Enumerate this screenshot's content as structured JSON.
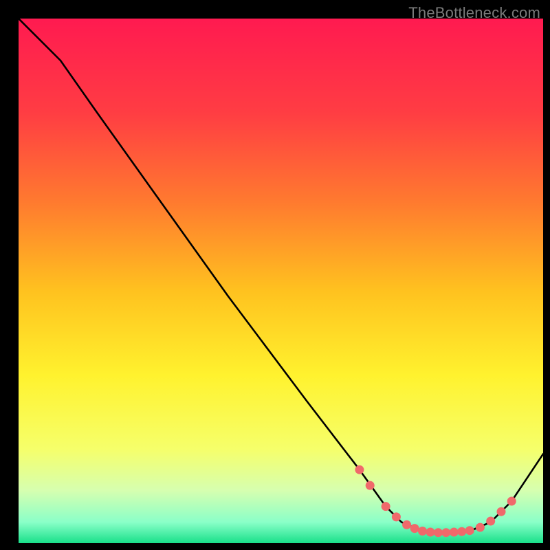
{
  "watermark": "TheBottleneck.com",
  "gradient": {
    "stops": [
      {
        "offset": 0.0,
        "color": "#ff1a50"
      },
      {
        "offset": 0.18,
        "color": "#ff3d43"
      },
      {
        "offset": 0.35,
        "color": "#ff7a2f"
      },
      {
        "offset": 0.52,
        "color": "#ffc21f"
      },
      {
        "offset": 0.68,
        "color": "#fff22e"
      },
      {
        "offset": 0.82,
        "color": "#f6ff6a"
      },
      {
        "offset": 0.9,
        "color": "#d6ffb0"
      },
      {
        "offset": 0.96,
        "color": "#8affc8"
      },
      {
        "offset": 1.0,
        "color": "#19e08a"
      }
    ]
  },
  "chart_data": {
    "type": "line",
    "title": "",
    "xlabel": "",
    "ylabel": "",
    "xlim": [
      0,
      100
    ],
    "ylim": [
      0,
      100
    ],
    "curve": [
      {
        "x": 0,
        "y": 100
      },
      {
        "x": 8,
        "y": 92
      },
      {
        "x": 15,
        "y": 82
      },
      {
        "x": 25,
        "y": 68
      },
      {
        "x": 40,
        "y": 47
      },
      {
        "x": 55,
        "y": 27
      },
      {
        "x": 65,
        "y": 14
      },
      {
        "x": 70,
        "y": 7
      },
      {
        "x": 73,
        "y": 4
      },
      {
        "x": 77,
        "y": 2.3
      },
      {
        "x": 82,
        "y": 2.0
      },
      {
        "x": 86,
        "y": 2.3
      },
      {
        "x": 90,
        "y": 4
      },
      {
        "x": 94,
        "y": 8
      },
      {
        "x": 100,
        "y": 17
      }
    ],
    "markers": [
      {
        "x": 65,
        "y": 14
      },
      {
        "x": 67,
        "y": 11
      },
      {
        "x": 70,
        "y": 7
      },
      {
        "x": 72,
        "y": 5
      },
      {
        "x": 74,
        "y": 3.5
      },
      {
        "x": 75.5,
        "y": 2.8
      },
      {
        "x": 77,
        "y": 2.3
      },
      {
        "x": 78.5,
        "y": 2.1
      },
      {
        "x": 80,
        "y": 2.0
      },
      {
        "x": 81.5,
        "y": 2.0
      },
      {
        "x": 83,
        "y": 2.1
      },
      {
        "x": 84.5,
        "y": 2.2
      },
      {
        "x": 86,
        "y": 2.4
      },
      {
        "x": 88,
        "y": 3.0
      },
      {
        "x": 90,
        "y": 4.2
      },
      {
        "x": 92,
        "y": 6.0
      },
      {
        "x": 94,
        "y": 8.0
      }
    ],
    "marker_color": "#f0696b",
    "line_color": "#000000",
    "line_width": 2.6
  }
}
